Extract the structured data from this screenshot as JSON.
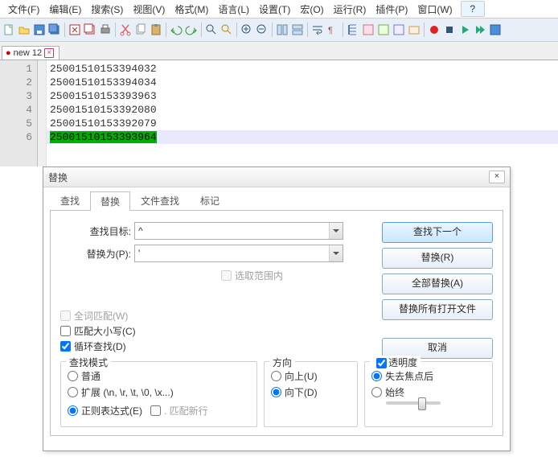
{
  "menu": {
    "file": "文件(F)",
    "edit": "编辑(E)",
    "search": "搜索(S)",
    "view": "视图(V)",
    "format": "格式(M)",
    "language": "语言(L)",
    "settings": "设置(T)",
    "macro": "宏(O)",
    "run": "运行(R)",
    "plugins": "插件(P)",
    "window": "窗口(W)",
    "help": "?"
  },
  "tab": {
    "icon": "●",
    "name": "new 12",
    "close": "×"
  },
  "editor": {
    "lines": [
      {
        "n": "1",
        "text": "25001510153394032"
      },
      {
        "n": "2",
        "text": "25001510153394034"
      },
      {
        "n": "3",
        "text": "25001510153393963"
      },
      {
        "n": "4",
        "text": "25001510153392080"
      },
      {
        "n": "5",
        "text": "25001510153392079"
      },
      {
        "n": "6",
        "text": "25001510153393964"
      }
    ]
  },
  "dialog": {
    "title": "替换",
    "close": "×",
    "tabs": {
      "find": "查找",
      "replace": "替换",
      "findfiles": "文件查找",
      "mark": "标记"
    },
    "labels": {
      "find_what": "查找目标:",
      "replace_with": "替换为(P):"
    },
    "values": {
      "find_what": "^",
      "replace_with": "'"
    },
    "in_selection": "选取范围内",
    "buttons": {
      "find_next": "查找下一个",
      "replace": "替换(R)",
      "replace_all": "全部替换(A)",
      "replace_all_open": "替换所有打开文件",
      "cancel": "取消"
    },
    "opts": {
      "whole_word": "全词匹配(W)",
      "match_case": "匹配大小写(C)",
      "wrap": "循环查找(D)"
    },
    "group_mode": {
      "title": "查找模式",
      "normal": "普通",
      "extended": "扩展 (\\n, \\r, \\t, \\0, \\x...)",
      "regex": "正则表达式(E)",
      "newline": ". 匹配新行"
    },
    "group_dir": {
      "title": "方向",
      "up": "向上(U)",
      "down": "向下(D)"
    },
    "group_trans": {
      "title": "透明度",
      "on_lose": "失去焦点后",
      "always": "始终"
    }
  }
}
